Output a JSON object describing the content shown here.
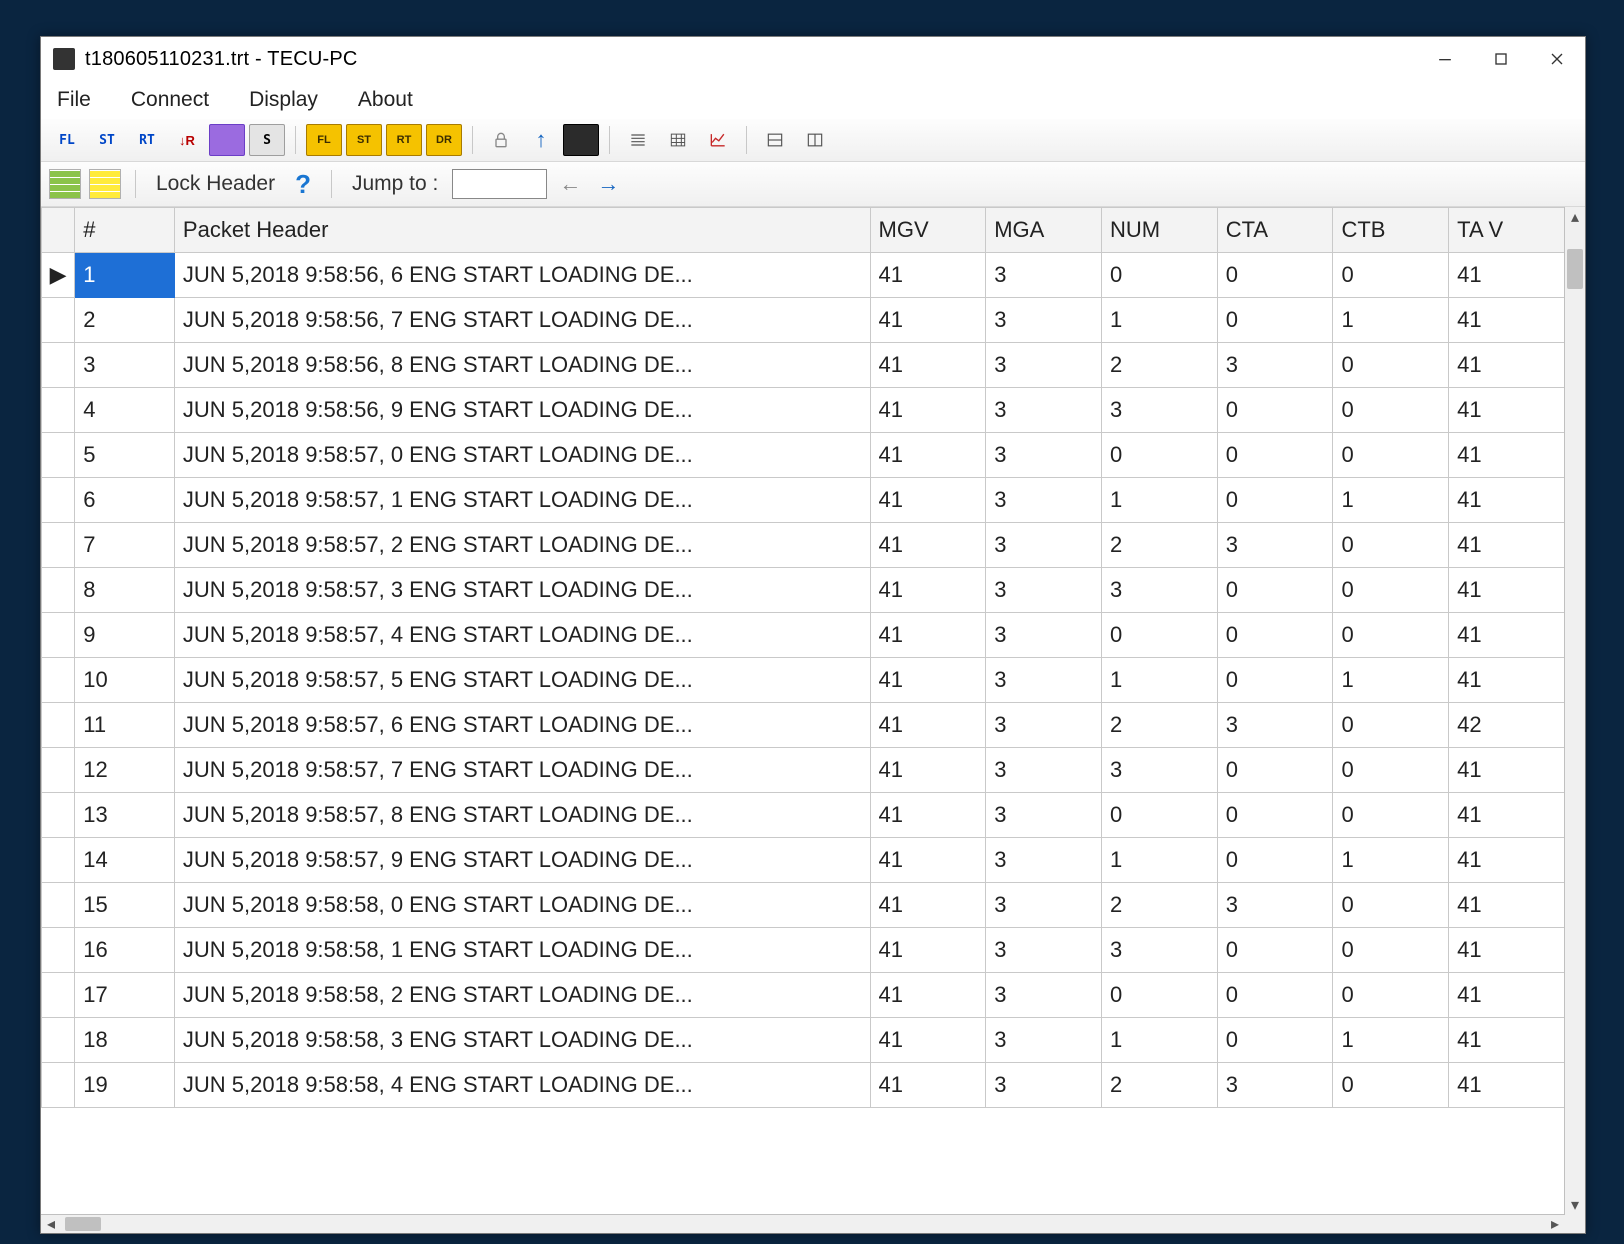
{
  "window": {
    "title": "t180605110231.trt - TECU-PC"
  },
  "menu": {
    "file": "File",
    "connect": "Connect",
    "display": "Display",
    "about": "About"
  },
  "toolbar": {
    "fl": "FL",
    "st": "ST",
    "rt": "RT",
    "dr": "↓R",
    "ybtn1": "FL",
    "ybtn2": "ST",
    "ybtn3": "RT",
    "ybtn4": "DR"
  },
  "toolbar2": {
    "lock": "Lock Header",
    "jump": "Jump to :",
    "jump_value": ""
  },
  "columns": {
    "blank": "",
    "num": "#",
    "packet": "Packet Header",
    "mgv": "MGV",
    "mga": "MGA",
    "numc": "NUM",
    "cta": "CTA",
    "ctb": "CTB",
    "tav": "TA V"
  },
  "rows": [
    {
      "n": "1",
      "ph": "JUN  5,2018  9:58:56, 6   ENG START LOADING DE...",
      "mgv": "41",
      "mga": "3",
      "num": "0",
      "cta": "0",
      "ctb": "0",
      "tav": "41",
      "sel": true
    },
    {
      "n": "2",
      "ph": "JUN  5,2018  9:58:56, 7   ENG START LOADING DE...",
      "mgv": "41",
      "mga": "3",
      "num": "1",
      "cta": "0",
      "ctb": "1",
      "tav": "41"
    },
    {
      "n": "3",
      "ph": "JUN  5,2018  9:58:56, 8   ENG START LOADING DE...",
      "mgv": "41",
      "mga": "3",
      "num": "2",
      "cta": "3",
      "ctb": "0",
      "tav": "41"
    },
    {
      "n": "4",
      "ph": "JUN  5,2018  9:58:56, 9   ENG START LOADING DE...",
      "mgv": "41",
      "mga": "3",
      "num": "3",
      "cta": "0",
      "ctb": "0",
      "tav": "41"
    },
    {
      "n": "5",
      "ph": "JUN  5,2018  9:58:57, 0   ENG START LOADING DE...",
      "mgv": "41",
      "mga": "3",
      "num": "0",
      "cta": "0",
      "ctb": "0",
      "tav": "41"
    },
    {
      "n": "6",
      "ph": "JUN  5,2018  9:58:57, 1   ENG START LOADING DE...",
      "mgv": "41",
      "mga": "3",
      "num": "1",
      "cta": "0",
      "ctb": "1",
      "tav": "41"
    },
    {
      "n": "7",
      "ph": "JUN  5,2018  9:58:57, 2   ENG START LOADING DE...",
      "mgv": "41",
      "mga": "3",
      "num": "2",
      "cta": "3",
      "ctb": "0",
      "tav": "41"
    },
    {
      "n": "8",
      "ph": "JUN  5,2018  9:58:57, 3   ENG START LOADING DE...",
      "mgv": "41",
      "mga": "3",
      "num": "3",
      "cta": "0",
      "ctb": "0",
      "tav": "41"
    },
    {
      "n": "9",
      "ph": "JUN  5,2018  9:58:57, 4   ENG START LOADING DE...",
      "mgv": "41",
      "mga": "3",
      "num": "0",
      "cta": "0",
      "ctb": "0",
      "tav": "41"
    },
    {
      "n": "10",
      "ph": "JUN  5,2018  9:58:57, 5   ENG START LOADING DE...",
      "mgv": "41",
      "mga": "3",
      "num": "1",
      "cta": "0",
      "ctb": "1",
      "tav": "41"
    },
    {
      "n": "11",
      "ph": "JUN  5,2018  9:58:57, 6   ENG START LOADING DE...",
      "mgv": "41",
      "mga": "3",
      "num": "2",
      "cta": "3",
      "ctb": "0",
      "tav": "42"
    },
    {
      "n": "12",
      "ph": "JUN  5,2018  9:58:57, 7   ENG START LOADING DE...",
      "mgv": "41",
      "mga": "3",
      "num": "3",
      "cta": "0",
      "ctb": "0",
      "tav": "41"
    },
    {
      "n": "13",
      "ph": "JUN  5,2018  9:58:57, 8   ENG START LOADING DE...",
      "mgv": "41",
      "mga": "3",
      "num": "0",
      "cta": "0",
      "ctb": "0",
      "tav": "41"
    },
    {
      "n": "14",
      "ph": "JUN  5,2018  9:58:57, 9   ENG START LOADING DE...",
      "mgv": "41",
      "mga": "3",
      "num": "1",
      "cta": "0",
      "ctb": "1",
      "tav": "41"
    },
    {
      "n": "15",
      "ph": "JUN  5,2018  9:58:58, 0   ENG START LOADING DE...",
      "mgv": "41",
      "mga": "3",
      "num": "2",
      "cta": "3",
      "ctb": "0",
      "tav": "41"
    },
    {
      "n": "16",
      "ph": "JUN  5,2018  9:58:58, 1   ENG START LOADING DE...",
      "mgv": "41",
      "mga": "3",
      "num": "3",
      "cta": "0",
      "ctb": "0",
      "tav": "41"
    },
    {
      "n": "17",
      "ph": "JUN  5,2018  9:58:58, 2   ENG START LOADING DE...",
      "mgv": "41",
      "mga": "3",
      "num": "0",
      "cta": "0",
      "ctb": "0",
      "tav": "41"
    },
    {
      "n": "18",
      "ph": "JUN  5,2018  9:58:58, 3   ENG START LOADING DE...",
      "mgv": "41",
      "mga": "3",
      "num": "1",
      "cta": "0",
      "ctb": "1",
      "tav": "41"
    },
    {
      "n": "19",
      "ph": "JUN  5,2018  9:58:58, 4   ENG START LOADING DE...",
      "mgv": "41",
      "mga": "3",
      "num": "2",
      "cta": "3",
      "ctb": "0",
      "tav": "41"
    }
  ]
}
